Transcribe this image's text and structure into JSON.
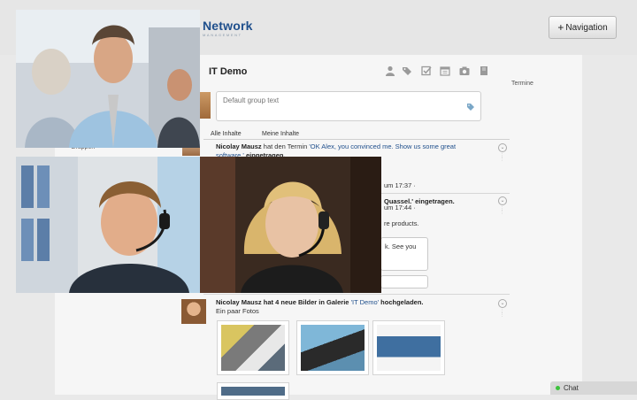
{
  "header": {
    "brand_main": "Network",
    "brand_sub": "MANAGEMENT",
    "navigation_label": "Navigation",
    "navigation_plus": "+"
  },
  "group": {
    "title": "IT Demo",
    "right_label": "Termine",
    "toolbar_icons": [
      "user-icon",
      "tags-icon",
      "checkbox-icon",
      "calendar-icon",
      "camera-icon",
      "book-icon"
    ]
  },
  "composer": {
    "placeholder": "Default group text"
  },
  "filters": {
    "all": "Alle Inhalte",
    "mine": "Meine Inhalte"
  },
  "sidebar": {
    "groups_label": "Gruppen"
  },
  "feed": {
    "post1": {
      "author": "Nicolay Mausz",
      "action": "hat den Termin",
      "link": "'OK Alex, you convinced me. Show us some great software.'",
      "link_line1": "'OK Alex, you convinced me. Show us some great",
      "link_line2": "software.'",
      "suffix": "eingetragen.",
      "time": "um 17:37 ·"
    },
    "post2": {
      "title_fragment": "Quassel.' eingetragen.",
      "time": "um 17:44 ·",
      "body1": "re products.",
      "body2": "k. See you"
    },
    "post3": {
      "author": "Nicolay Mausz",
      "action": "hat 4 neue Bilder in Galerie",
      "link": "'IT Demo'",
      "suffix": "hochgeladen.",
      "caption": "Ein paar Fotos"
    }
  },
  "chat": {
    "label": "Chat",
    "status_color": "#3cc23c"
  },
  "colors": {
    "brand": "#1f4f8c",
    "link": "#1f4f8c"
  }
}
